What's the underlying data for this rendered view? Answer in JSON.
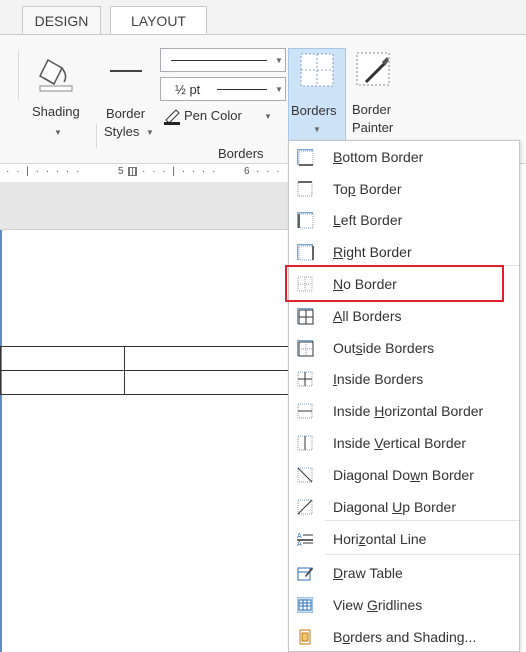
{
  "tabs": {
    "design": "DESIGN",
    "layout": "LAYOUT"
  },
  "ribbon": {
    "shading_label": "Shading",
    "border_styles_label_1": "Border",
    "border_styles_label_2": "Styles",
    "line_weight": "½ pt",
    "pen_color_label": "Pen Color",
    "borders_label": "Borders",
    "border_painter_label_1": "Border",
    "border_painter_label_2": "Painter",
    "group_label": "Borders"
  },
  "ruler": {
    "marker_5": "5",
    "marker_6": "6"
  },
  "menu": {
    "items": [
      {
        "pre": "",
        "u": "B",
        "post": "ottom Border",
        "icon": "bottom-border-icon"
      },
      {
        "pre": "To",
        "u": "p",
        "post": " Border",
        "icon": "top-border-icon"
      },
      {
        "pre": "",
        "u": "L",
        "post": "eft Border",
        "icon": "left-border-icon"
      },
      {
        "pre": "",
        "u": "R",
        "post": "ight Border",
        "icon": "right-border-icon"
      },
      {
        "pre": "",
        "u": "N",
        "post": "o Border",
        "icon": "no-border-icon"
      },
      {
        "pre": "",
        "u": "A",
        "post": "ll Borders",
        "icon": "all-borders-icon"
      },
      {
        "pre": "Out",
        "u": "s",
        "post": "ide Borders",
        "icon": "outside-borders-icon"
      },
      {
        "pre": "",
        "u": "I",
        "post": "nside Borders",
        "icon": "inside-borders-icon"
      },
      {
        "pre": "Inside ",
        "u": "H",
        "post": "orizontal Border",
        "icon": "inside-horizontal-border-icon"
      },
      {
        "pre": "Inside ",
        "u": "V",
        "post": "ertical Border",
        "icon": "inside-vertical-border-icon"
      },
      {
        "pre": "Diagonal Do",
        "u": "w",
        "post": "n Border",
        "icon": "diagonal-down-border-icon"
      },
      {
        "pre": "Diagonal ",
        "u": "U",
        "post": "p Border",
        "icon": "diagonal-up-border-icon"
      },
      {
        "pre": "Hori",
        "u": "z",
        "post": "ontal Line",
        "icon": "horizontal-line-icon"
      },
      {
        "pre": "",
        "u": "D",
        "post": "raw Table",
        "icon": "draw-table-icon"
      },
      {
        "pre": "View ",
        "u": "G",
        "post": "ridlines",
        "icon": "view-gridlines-icon"
      },
      {
        "pre": "B",
        "u": "o",
        "post": "rders and Shading...",
        "icon": "borders-and-shading-icon"
      }
    ]
  },
  "colors": {
    "accent": "#5a8fc8",
    "highlight": "#e0202a",
    "selected": "#cde3f7"
  }
}
